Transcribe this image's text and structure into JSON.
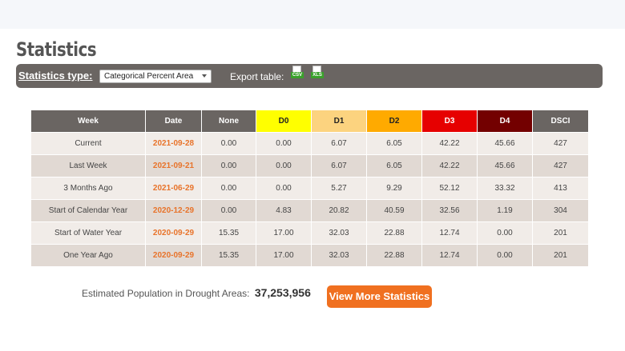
{
  "page": {
    "title": "Statistics"
  },
  "toolbar": {
    "stat_type_label": "Statistics type:",
    "stat_type_value": "Categorical Percent Area",
    "export_label": "Export table:",
    "csv_label": "CSV",
    "xls_label": "XLS"
  },
  "table": {
    "headers": [
      "Week",
      "Date",
      "None",
      "D0",
      "D1",
      "D2",
      "D3",
      "D4",
      "DSCI"
    ],
    "rows": [
      [
        "Current",
        "2021-09-28",
        "0.00",
        "0.00",
        "6.07",
        "6.05",
        "42.22",
        "45.66",
        "427"
      ],
      [
        "Last Week",
        "2021-09-21",
        "0.00",
        "0.00",
        "6.07",
        "6.05",
        "42.22",
        "45.66",
        "427"
      ],
      [
        "3 Months Ago",
        "2021-06-29",
        "0.00",
        "0.00",
        "5.27",
        "9.29",
        "52.12",
        "33.32",
        "413"
      ],
      [
        "Start of Calendar Year",
        "2020-12-29",
        "0.00",
        "4.83",
        "20.82",
        "40.59",
        "32.56",
        "1.19",
        "304"
      ],
      [
        "Start of Water Year",
        "2020-09-29",
        "15.35",
        "17.00",
        "32.03",
        "22.88",
        "12.74",
        "0.00",
        "201"
      ],
      [
        "One Year Ago",
        "2020-09-29",
        "15.35",
        "17.00",
        "32.03",
        "22.88",
        "12.74",
        "0.00",
        "201"
      ]
    ]
  },
  "population": {
    "label": "Estimated Population in Drought Areas:",
    "value": "37,253,956"
  },
  "more_button": {
    "label": "View More Statistics"
  },
  "colors": {
    "d0": "#ffff00",
    "d1": "#fcd37f",
    "d2": "#ffaa00",
    "d3": "#e60000",
    "d4": "#730000",
    "accent": "#f07020",
    "toolbar": "#6a6562"
  },
  "icons": {
    "csv": "csv-file-icon",
    "xls": "xls-file-icon",
    "select_caret": "chevron-down-icon"
  }
}
